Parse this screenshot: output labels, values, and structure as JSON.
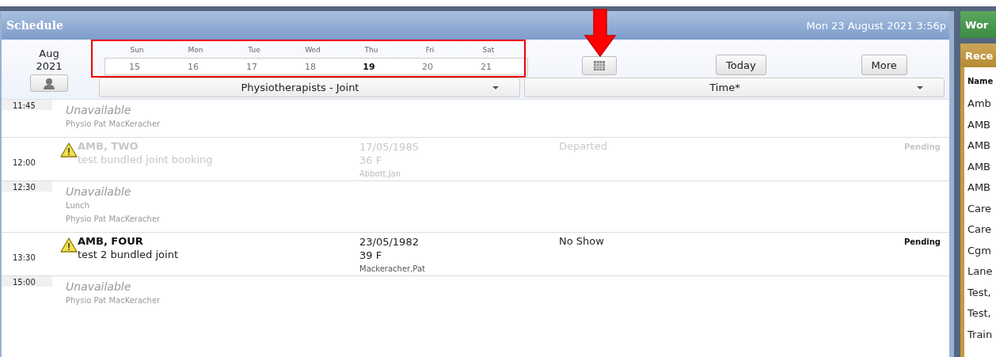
{
  "schedule": {
    "title": "Schedule",
    "datetime": "Mon 23 August 2021 3:56p"
  },
  "month": "Aug",
  "year": "2021",
  "days": [
    {
      "name": "Sun",
      "date": "15",
      "selected": false
    },
    {
      "name": "Mon",
      "date": "16",
      "selected": false
    },
    {
      "name": "Tue",
      "date": "17",
      "selected": false
    },
    {
      "name": "Wed",
      "date": "18",
      "selected": false
    },
    {
      "name": "Thu",
      "date": "19",
      "selected": true
    },
    {
      "name": "Fri",
      "date": "20",
      "selected": false
    },
    {
      "name": "Sat",
      "date": "21",
      "selected": false
    }
  ],
  "buttons": [
    "Today",
    "More"
  ],
  "dropdowns": [
    "Physiotherapists - Joint",
    "Time*"
  ],
  "rows": [
    {
      "kind": "unavailable",
      "time": "11:45",
      "title": "Unavailable",
      "lines": [
        "Physio Pat MacKeracher"
      ]
    },
    {
      "kind": "booking",
      "time": "12:00",
      "dimmed": true,
      "warning": true,
      "name": "AMB, TWO",
      "desc": "test bundled joint booking",
      "dob": "17/05/1985",
      "age": "36 F",
      "clinician": "Abbott,Jan",
      "status": "Departed",
      "state": "Pending"
    },
    {
      "kind": "unavailable",
      "time": "12:30",
      "title": "Unavailable",
      "lines": [
        "Lunch",
        "Physio Pat MacKeracher"
      ]
    },
    {
      "kind": "booking",
      "time": "13:30",
      "dimmed": false,
      "warning": true,
      "name": "AMB, FOUR",
      "desc": "test 2 bundled joint",
      "dob": "23/05/1982",
      "age": "39 F",
      "clinician": "Mackeracher,Pat",
      "status": "No Show",
      "state": "Pending"
    },
    {
      "kind": "unavailable",
      "time": "15:00",
      "title": "Unavailable",
      "lines": [
        "Physio Pat MacKeracher"
      ]
    }
  ],
  "side": {
    "title": "Wor",
    "section": "Rece",
    "column": "Name",
    "items": [
      "Amb",
      "AMB",
      "AMB",
      "AMB",
      "AMB",
      "Care",
      "Care",
      "Cgm",
      "Lane",
      "Test,",
      "Test,",
      "Train"
    ]
  }
}
